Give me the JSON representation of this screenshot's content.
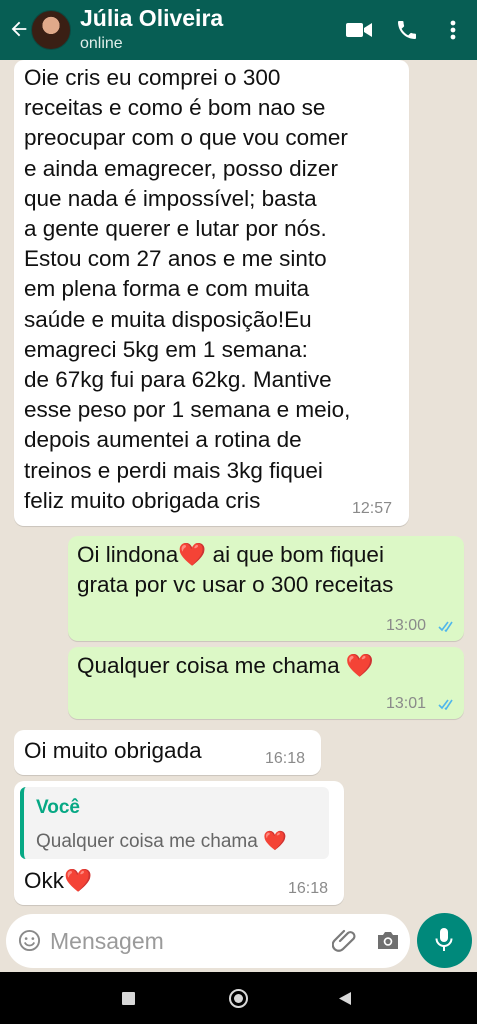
{
  "header": {
    "contact_name": "Júlia Oliveira",
    "status": "online"
  },
  "messages": [
    {
      "direction": "incoming",
      "text": "Oie cris eu comprei o 300\nreceitas e como é bom nao se\npreocupar com o que vou comer\ne ainda emagrecer, posso dizer\nque nada é impossível; basta\na gente querer e lutar por nós.\nEstou com 27 anos e me sinto\nem plena forma e com muita\nsaúde e muita disposição!Eu\nemagreci 5kg em 1 semana:\nde 67kg fui para 62kg. Mantive\nesse peso por 1 semana e meio,\ndepois aumentei a rotina de\ntreinos e perdi mais 3kg fiquei\nfeliz muito obrigada cris",
      "time": "12:57"
    },
    {
      "direction": "outgoing",
      "text": "Oi lindona❤️ ai que bom fiquei\ngrata por vc usar o 300 receitas",
      "time": "13:00",
      "read": true
    },
    {
      "direction": "outgoing",
      "text": "Qualquer coisa me chama ❤️",
      "time": "13:01",
      "read": true
    },
    {
      "direction": "incoming",
      "text": "Oi muito obrigada",
      "time": "16:18"
    },
    {
      "direction": "incoming",
      "reply_to": {
        "author": "Você",
        "text": "Qualquer coisa me chama ❤️"
      },
      "text": "Okk❤️",
      "time": "16:18"
    }
  ],
  "input": {
    "placeholder": "Mensagem"
  },
  "colors": {
    "header_bg": "#075e54",
    "chat_bg": "#e9e2d8",
    "incoming_bubble": "#ffffff",
    "outgoing_bubble": "#dcf8c6",
    "read_ticks": "#4fb6ec",
    "accent_fab": "#00897b",
    "reply_bar": "#06a884"
  },
  "icons": {
    "header": [
      "back-arrow-icon",
      "video-call-icon",
      "phone-icon",
      "more-options-icon"
    ],
    "input": [
      "emoji-icon",
      "attach-icon",
      "camera-icon",
      "mic-icon"
    ],
    "navbar": [
      "recent-apps-icon",
      "home-icon",
      "back-nav-icon"
    ]
  }
}
